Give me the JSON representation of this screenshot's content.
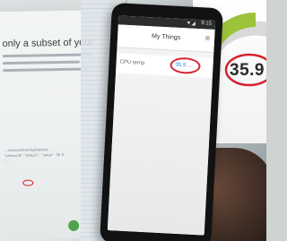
{
  "monitor": {
    "heading": "only a subset of your",
    "code_text": "...ents/on/GettingStarted... \"sensorId\": \"tempC\", \"value\": 35.9 ..."
  },
  "phone": {
    "status": {
      "signal": "▼◢",
      "time": "9:15"
    },
    "app_title": "My Things",
    "menu_icon": "≡",
    "thing": {
      "name": "CPU temp",
      "value": "35.9 ..."
    }
  },
  "gauge": {
    "value": "35.9",
    "colors": {
      "fill": "#9cc33a",
      "track": "#d9d9d9"
    }
  }
}
